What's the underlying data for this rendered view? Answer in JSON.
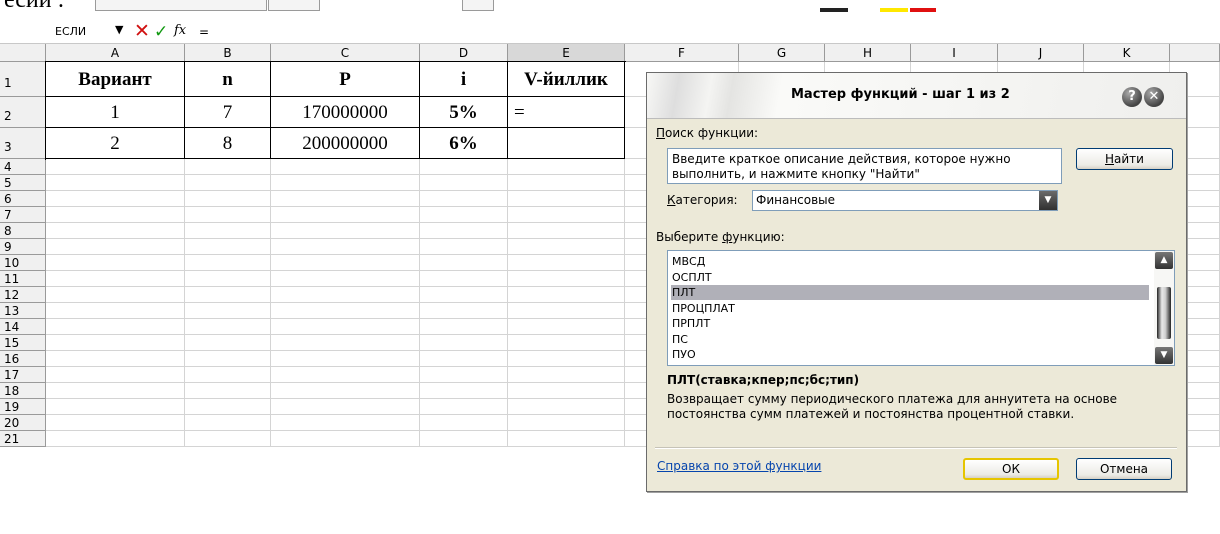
{
  "doc": {
    "top_text": "есии :"
  },
  "formula_bar": {
    "name_box": "ЕСЛИ",
    "name_arrow": "▼",
    "cancel_icon": "✕",
    "enter_icon": "✓",
    "fx_label": "fx",
    "value": "="
  },
  "columns": [
    "A",
    "B",
    "C",
    "D",
    "E",
    "F",
    "G",
    "H",
    "I",
    "J",
    "K"
  ],
  "rows": [
    "1",
    "2",
    "3",
    "4",
    "5",
    "6",
    "7",
    "8",
    "9",
    "10",
    "11",
    "12",
    "13",
    "14",
    "15",
    "16",
    "17",
    "18",
    "19",
    "20",
    "21"
  ],
  "table": {
    "headers": [
      "Вариант",
      "n",
      "P",
      "i",
      "V-йиллик"
    ],
    "data": [
      [
        "1",
        "7",
        "170000000",
        "5%",
        "="
      ],
      [
        "2",
        "8",
        "200000000",
        "6%",
        ""
      ]
    ]
  },
  "dialog": {
    "title": "Мастер функций - шаг 1 из 2",
    "help_icon": "?",
    "close_icon": "✕",
    "search_label_key": "П",
    "search_label_rest": "оиск функции:",
    "search_text": "Введите краткое описание действия, которое нужно выполнить, и нажмите кнопку \"Найти\"",
    "find_key": "Н",
    "find_rest": "айти",
    "category_label_key": "К",
    "category_label_rest": "атегория:",
    "category_value": "Финансовые",
    "select_label_pre": "Выберите ",
    "select_label_key": "ф",
    "select_label_rest": "ункцию:",
    "functions": [
      "МВСД",
      "ОСПЛТ",
      "ПЛТ",
      "ПРОЦПЛАТ",
      "ПРПЛТ",
      "ПС",
      "ПУО"
    ],
    "selected_function": "ПЛТ",
    "syntax": "ПЛТ(ставка;кпер;пс;бс;тип)",
    "description": "Возвращает сумму периодического платежа для аннуитета на основе постоянства сумм платежей и постоянства процентной ставки.",
    "help_link": "Справка по этой функции",
    "ok_label": "ОК",
    "cancel_label": "Отмена"
  }
}
